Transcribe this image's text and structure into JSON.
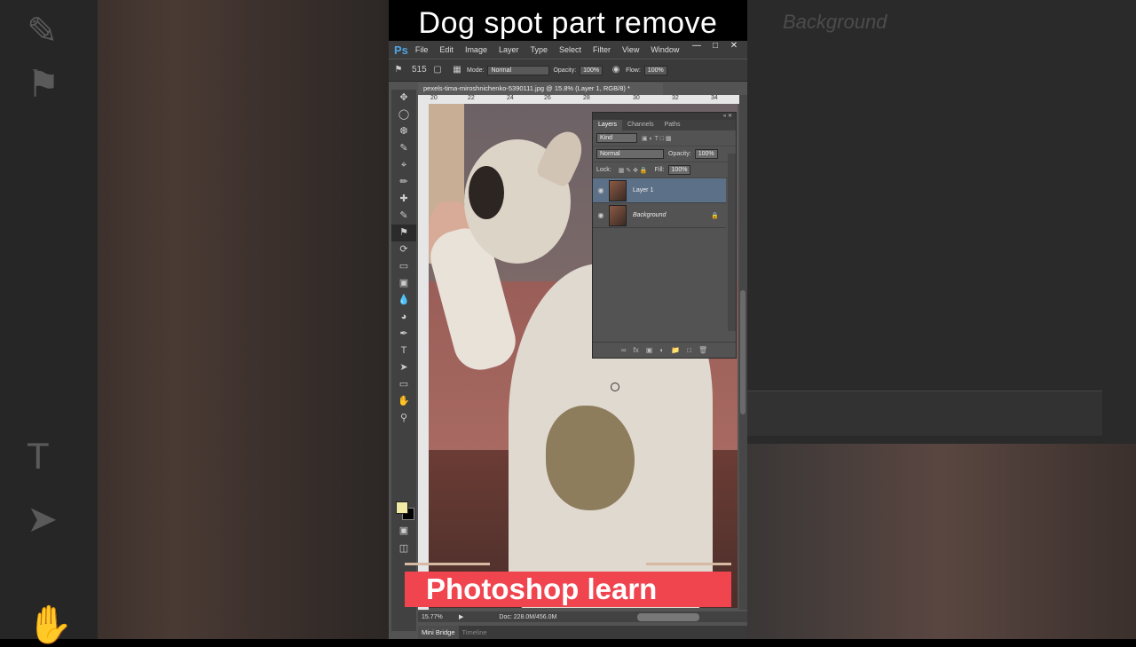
{
  "overlay": {
    "title": "Dog spot part remove",
    "banner": "Photoshop learn"
  },
  "menubar": {
    "logo": "Ps",
    "items": [
      "File",
      "Edit",
      "Image",
      "Layer",
      "Type",
      "Select",
      "Filter",
      "View",
      "Window"
    ],
    "window_buttons": [
      "—",
      "□",
      "✕"
    ]
  },
  "options_bar": {
    "brush_size": "515",
    "mode_label": "Mode:",
    "mode_value": "Normal",
    "opacity_label": "Opacity:",
    "opacity_value": "100%",
    "flow_label": "Flow:",
    "flow_value": "100%"
  },
  "document": {
    "tab_title": "pexels-tima-miroshnichenko-5390111.jpg @ 15.8% (Layer 1, RGB/8) *",
    "ruler_top": [
      "20",
      "22",
      "24",
      "26",
      "28",
      "30",
      "32",
      "34"
    ]
  },
  "layers_panel": {
    "tabs": [
      "Layers",
      "Channels",
      "Paths"
    ],
    "filter_kind": "Kind",
    "blend_mode": "Normal",
    "opacity_label": "Opacity:",
    "opacity_value": "100%",
    "lock_label": "Lock:",
    "fill_label": "Fill:",
    "fill_value": "100%",
    "layers": [
      {
        "name": "Layer 1",
        "selected": true
      },
      {
        "name": "Background",
        "selected": false,
        "locked": true
      }
    ]
  },
  "status_bar": {
    "zoom": "15.77%",
    "doc_info": "Doc: 228.0M/456.0M"
  },
  "bottom_tabs": [
    "Mini Bridge",
    "Timeline"
  ],
  "background_ghost": {
    "right_label": "Background"
  },
  "colors": {
    "foreground_swatch": "#f1e9a6",
    "background_swatch": "#000000",
    "banner_red": "#f0444f",
    "selected_layer": "#5c7088"
  }
}
